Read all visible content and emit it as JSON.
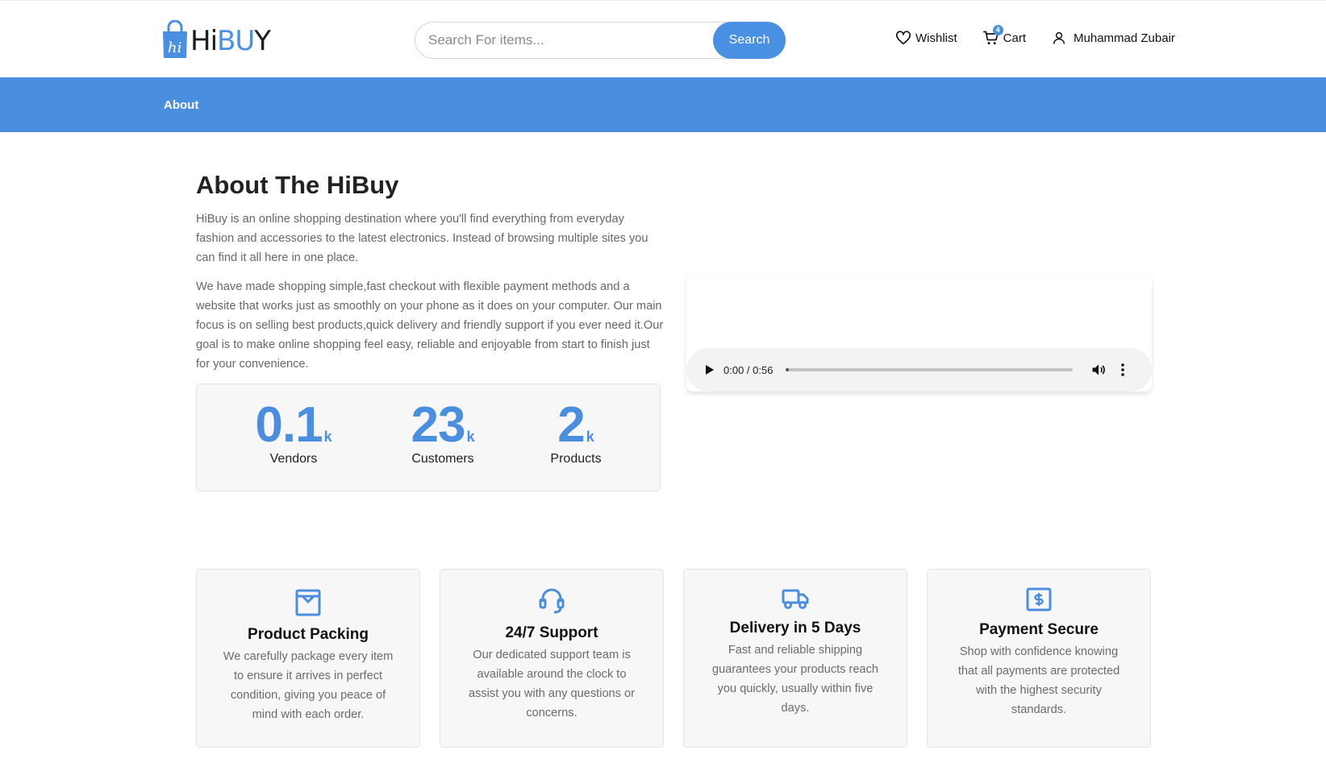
{
  "header": {
    "logo_text_a": "Hi",
    "logo_text_b": "BU",
    "logo_text_c": "Y",
    "search_placeholder": "Search For items...",
    "search_button": "Search",
    "wishlist_label": "Wishlist",
    "cart_label": "Cart",
    "cart_count": "4",
    "user_name": "Muhammad Zubair"
  },
  "breadcrumb": {
    "label": "About"
  },
  "about": {
    "title": "About The HiBuy",
    "paragraph1": "HiBuy is an online shopping destination where you'll find everything from everyday fashion and accessories to the latest electronics. Instead of browsing multiple sites you can find it all here in one place.",
    "paragraph2": "We have made shopping simple,fast checkout with flexible payment methods and a website that works just as smoothly on your phone as it does on your computer. Our main focus is on selling best products,quick delivery and friendly support if you ever need it.Our goal is to make online shopping feel easy, reliable and enjoyable from start to finish just for your convenience."
  },
  "stats": [
    {
      "value": "0.1",
      "unit": "k",
      "label": "Vendors"
    },
    {
      "value": "23",
      "unit": "k",
      "label": "Customers"
    },
    {
      "value": "2",
      "unit": "k",
      "label": "Products"
    }
  ],
  "video": {
    "time": "0:00 / 0:56",
    "progress": 0
  },
  "features": [
    {
      "icon": "package-icon",
      "title": "Product Packing",
      "text": "We carefully package every item to ensure it arrives in perfect condition, giving you peace of mind with each order."
    },
    {
      "icon": "headset-icon",
      "title": "24/7 Support",
      "text": "Our dedicated support team is available around the clock to assist you with any questions or concerns."
    },
    {
      "icon": "truck-icon",
      "title": "Delivery in 5 Days",
      "text": "Fast and reliable shipping guarantees your products reach you quickly, usually within five days."
    },
    {
      "icon": "dollar-icon",
      "title": "Payment Secure",
      "text": "Shop with confidence knowing that all payments are protected with the highest security standards."
    }
  ],
  "colors": {
    "accent": "#4a8ee0",
    "text": "#222222",
    "muted": "#676767"
  }
}
